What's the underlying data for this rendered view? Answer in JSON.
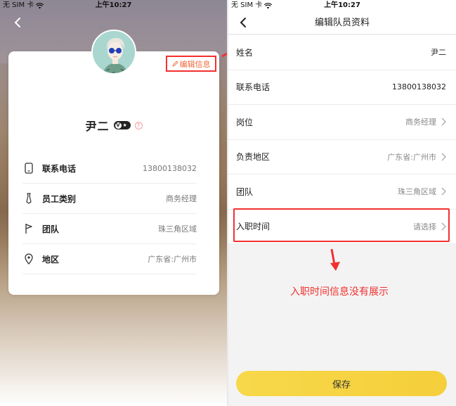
{
  "status": {
    "carrier": "无 SIM 卡",
    "time": "上午10:27"
  },
  "profile": {
    "edit_label": "编辑信息",
    "name": "尹二",
    "items": [
      {
        "label": "联系电话",
        "value": "13800138032",
        "icon": "phone-icon"
      },
      {
        "label": "员工类别",
        "value": "商务经理",
        "icon": "tie-icon"
      },
      {
        "label": "团队",
        "value": "珠三角区域",
        "icon": "flag-icon"
      },
      {
        "label": "地区",
        "value": "广东省:广州市",
        "icon": "location-pin-icon"
      }
    ]
  },
  "edit": {
    "title": "编辑队员资料",
    "rows": [
      {
        "label": "姓名",
        "value": "尹二",
        "chevron": false
      },
      {
        "label": "联系电话",
        "value": "13800138032",
        "chevron": false
      },
      {
        "label": "岗位",
        "value": "商务经理",
        "chevron": true
      },
      {
        "label": "负责地区",
        "value": "广东省:广州市",
        "chevron": true
      },
      {
        "label": "团队",
        "value": "珠三角区域",
        "chevron": true
      },
      {
        "label": "入职时间",
        "value": "请选择",
        "chevron": true
      }
    ],
    "annotation": "入职时间信息没有展示",
    "save_label": "保存"
  },
  "colors": {
    "accent_red": "#f23030",
    "save_yellow": "#f6d443",
    "edit_text": "#f06a3c"
  }
}
